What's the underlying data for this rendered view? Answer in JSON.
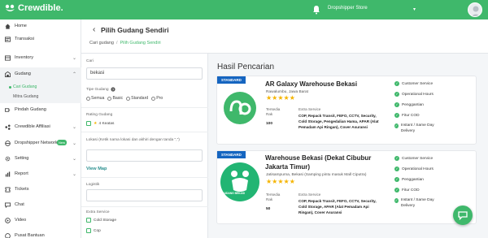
{
  "topbar": {
    "brand": "Crewdible.",
    "store": "Dropshipper Store",
    "bg_color": "#3fb86b"
  },
  "sidebar": {
    "items": [
      {
        "label": "Home",
        "icon": "home-icon"
      },
      {
        "label": "Transaksi",
        "icon": "transaction-icon"
      },
      {
        "label": "Inventory",
        "icon": "inventory-icon"
      },
      {
        "label": "Gudang",
        "icon": "warehouse-icon"
      },
      {
        "label": "Pindah Gudang",
        "icon": "move-icon"
      },
      {
        "label": "Crewdible Affiliasi",
        "icon": "affiliate-icon"
      },
      {
        "label": "Dropshipper Network",
        "icon": "network-icon",
        "badge": "New"
      },
      {
        "label": "Setting",
        "icon": "gear-icon"
      },
      {
        "label": "Report",
        "icon": "report-icon"
      },
      {
        "label": "Tickets",
        "icon": "ticket-icon"
      },
      {
        "label": "Chat",
        "icon": "chat-icon"
      },
      {
        "label": "Video",
        "icon": "video-icon"
      },
      {
        "label": "Pusat Bantuan",
        "icon": "help-icon"
      }
    ],
    "sub_items": [
      {
        "label": "Cari Gudang",
        "active": true
      },
      {
        "label": "Mitra Gudang",
        "active": false
      }
    ]
  },
  "header": {
    "title": "Pilih Gudang Sendiri",
    "breadcrumb": [
      "Cari gudang",
      "Pilih Gudang Sendiri"
    ]
  },
  "filter": {
    "search_label": "Cari",
    "search_value": "bekasi",
    "type_label": "Tipe Gudang",
    "type_options": [
      "Semua",
      "Basic",
      "Standard",
      "Pro"
    ],
    "rating_label": "Rating Gudang",
    "rating_option": "4 Keatas",
    "location_label": "Lokasi (Ketik nama lokasi dan akhiri dengan tanda \",\")",
    "view_map": "View Map",
    "logistic_label": "Logistik",
    "extra_label": "Extra Service",
    "extra_options": [
      "Cold Storage",
      "Cop"
    ]
  },
  "results": {
    "title": "Hasil Pencarian",
    "cards": [
      {
        "badge": "STANDARD",
        "name": "AR Galaxy Warehouse Bekasi",
        "location": "Rawalumbu, Jawa Barat",
        "stars": "★★★★★",
        "rak_label": "Tersedia Rak",
        "rak_value": "100",
        "extra_label": "Extra Service",
        "extra_value": "COP, Repack Transit, FEFO, CCTV, Security, Cold Storage, Pengedalian Hama, APAR (Alat Pemadam Api Ringan), Cover Asuransi",
        "features": [
          "Customer Service",
          "Operational Hours",
          "Penggantian",
          "Fitur COD",
          "Instant / Same Day Delivery"
        ],
        "logo_color": "#3fb86b"
      },
      {
        "badge": "STANDARD",
        "name": "Warehouse Bekasi (Dekat Cibubur Jakarta Timur)",
        "location": "Jatisampurna, Bekasi (Samping pintu masuk Mall Ciputra)",
        "stars": "★★★★★",
        "rak_label": "Tersedia Rak",
        "rak_value": "50",
        "extra_label": "Extra Service",
        "extra_value": "COP, Repack Transit, FEFO, CCTV, Security, Cold Storage, APAR (Alat Pemadam Api Ringan), Cover Asuransi",
        "features": [
          "Customer Service",
          "Operational Hours",
          "Penggantian",
          "Fitur COD",
          "Instant / Same Day Delivery"
        ],
        "logo_text": "GUDANG BEKASI",
        "logo_color": "#22b573"
      }
    ]
  }
}
